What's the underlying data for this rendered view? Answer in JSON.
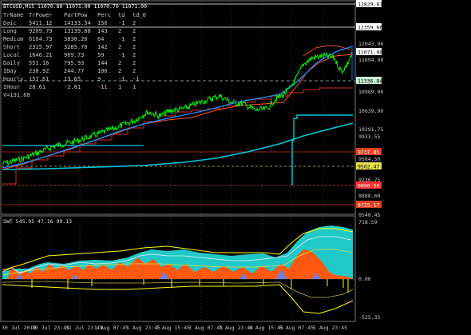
{
  "main": {
    "title": "BTCUSD,M15  11070.80 11071.00 11070.70 11071.00",
    "table": {
      "headers": [
        "TrName",
        "TrPower",
        "PartPow",
        "Perc",
        "td",
        "td_0"
      ],
      "rows": [
        [
          "Daic",
          "5411.12",
          "14133.54",
          "156",
          "-1",
          "2"
        ],
        [
          "Long",
          "9209.79",
          "13139.88",
          "143",
          "2",
          "2"
        ],
        [
          "Medium",
          "6104.73",
          "3830.20",
          "64",
          "-1",
          "2"
        ],
        [
          "Short",
          "2315.97",
          "3285.70",
          "142",
          "2",
          "2"
        ],
        [
          "Local",
          "1646.21",
          "969.73",
          "59",
          "-1",
          "2"
        ],
        [
          "Daily",
          "551.16",
          "795.93",
          "144",
          "2",
          "2"
        ],
        [
          "IDay",
          "230.92",
          "244.77",
          "106",
          "2",
          "2"
        ],
        [
          "Hourly",
          "157.81",
          "13.65",
          "9",
          "-1",
          "-1"
        ],
        [
          "IHour",
          "28.61",
          "-2.81",
          "-11",
          "1",
          "1"
        ]
      ],
      "vline": "V=191.68"
    },
    "price_ticks": [
      "12043.90",
      "11694.90",
      "10989.90",
      "10639.90",
      "10291.75",
      "9933.55",
      "9584.50",
      "9236.75",
      "8888.60",
      "8540.45"
    ],
    "price_labels": [
      {
        "text": "12829.67",
        "bg": "#ffffff",
        "fg": "#000000"
      },
      {
        "text": "12359.66",
        "bg": "#ffffff",
        "fg": "#000000"
      },
      {
        "text": "11071.00",
        "bg": "#ffffff",
        "fg": "#000000"
      },
      {
        "text": "11336.84",
        "bg": "#c8f0d0",
        "fg": "#000000"
      },
      {
        "text": "9737.85",
        "bg": "#e04020",
        "fg": "#ffffff"
      },
      {
        "text": "9502.47",
        "bg": "#e8e050",
        "fg": "#000000"
      },
      {
        "text": "9090.50",
        "bg": "#ff3030",
        "fg": "#ffffff"
      },
      {
        "text": "8725.17",
        "bg": "#e04020",
        "fg": "#ffffff"
      }
    ]
  },
  "sub": {
    "title": "SWT 545.95 47.16 99.13",
    "ticks": [
      "718.59",
      "0.00",
      "-525.35"
    ]
  },
  "time_axis": [
    "30 Jul 2019",
    "30 Jul 23:45",
    "31 Jul 23:45",
    "1 Aug 07:45",
    "1 Aug 23:45",
    "2 Aug 15:45",
    "3 Aug 07:45",
    "3 Aug 23:45",
    "4 Aug 15:45",
    "5 Aug 07:45",
    "5 Aug 23:45"
  ],
  "colors": {
    "price": "#00ff00",
    "ma_blue": "#1ea0ff",
    "cyan": "#00d0d0",
    "red": "#ff2000",
    "orange": "#ff7020",
    "yellow": "#ffff00",
    "aqua_fill": "#20d0d0",
    "grid": "#3a3a3a"
  }
}
